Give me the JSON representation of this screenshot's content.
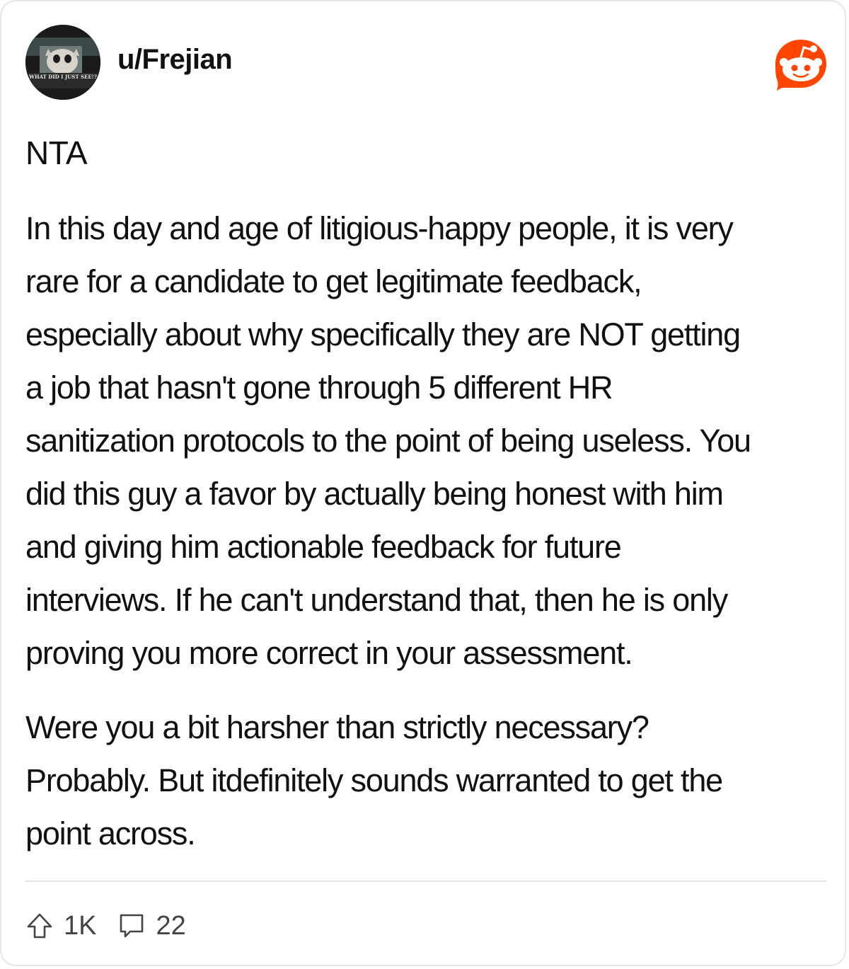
{
  "post": {
    "username": "u/Frejian",
    "avatar_caption": "WHAT DID I JUST SEE!?",
    "verdict": "NTA",
    "paragraph1_lines": [
      "In this day and age of litigious-happy people, it is very",
      "rare for a candidate to get legitimate feedback,",
      "especially about why specifically they are NOT getting",
      "a job that hasn't gone through 5 different HR",
      "sanitization protocols to the point of being useless. You",
      "did this guy a favor by actually being honest with him",
      "and giving him actionable feedback for future",
      "interviews. If he can't understand that, then he is only",
      "proving you more correct in your assessment."
    ],
    "paragraph2_lines": [
      "Were you a bit harsher than strictly necessary?",
      "Probably. But itdefinitely sounds warranted to get the",
      "point across."
    ]
  },
  "footer": {
    "upvotes": "1K",
    "comments": "22",
    "upvote_icon": "upvote-arrow-icon",
    "comment_icon": "comment-bubble-icon"
  },
  "brand": {
    "logo_icon": "reddit-logo-icon",
    "accent": "#ff4500"
  }
}
